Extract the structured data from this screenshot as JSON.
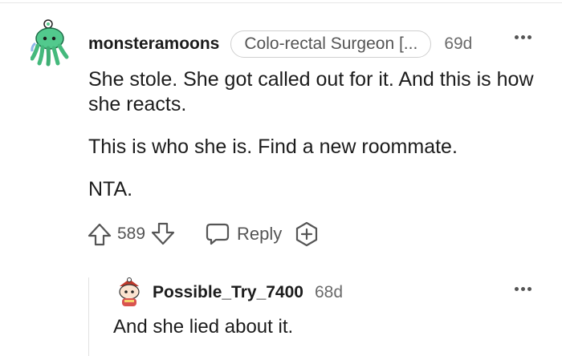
{
  "comment": {
    "username": "monsteramoons",
    "flair": "Colo-rectal Surgeon [...",
    "age": "69d",
    "paragraphs": [
      "She stole. She got called out for it. And this is how she reacts.",
      "This is who she is. Find a new roommate.",
      "NTA."
    ],
    "score": "589",
    "reply_label": "Reply",
    "icons": [
      "upvote-icon",
      "downvote-icon",
      "reply-bubble-icon",
      "award-icon",
      "more-icon"
    ]
  },
  "reply": {
    "username": "Possible_Try_7400",
    "age": "68d",
    "text": "And she lied about it."
  },
  "colors": {
    "accent": "#47c28a",
    "text": "#1c1c1c",
    "muted": "#6a6a6a",
    "border": "#cfcfcf"
  }
}
